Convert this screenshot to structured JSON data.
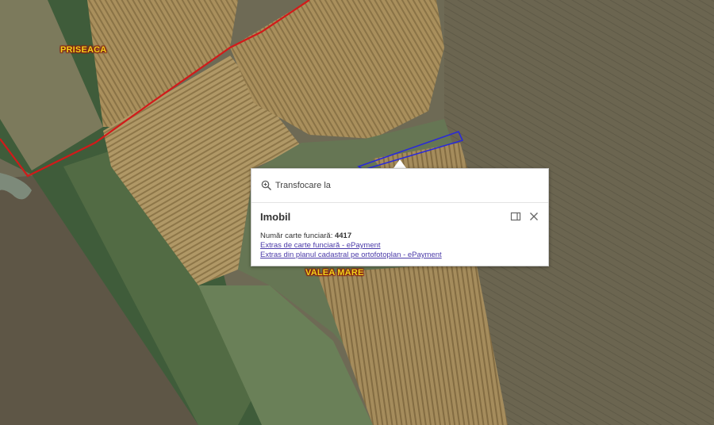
{
  "map": {
    "places": [
      {
        "name": "PRISEACA"
      },
      {
        "name": "VALEA MARE"
      }
    ],
    "colors": {
      "boundary": "#d21a1a",
      "parcel_outline": "#2a2ad8",
      "label_fill": "#f2d31b"
    }
  },
  "popup": {
    "zoom_label": "Transfocare la",
    "zoom_icon": "zoom-in-icon",
    "title": "Imobil",
    "actions": [
      {
        "icon": "dock-icon"
      },
      {
        "icon": "close-icon"
      }
    ],
    "field_label": "Număr carte funciară:",
    "field_value": "4417",
    "links": [
      "Extras de carte funciară - ePayment",
      "Extras din planul cadastral pe ortofotoplan - ePayment"
    ]
  }
}
